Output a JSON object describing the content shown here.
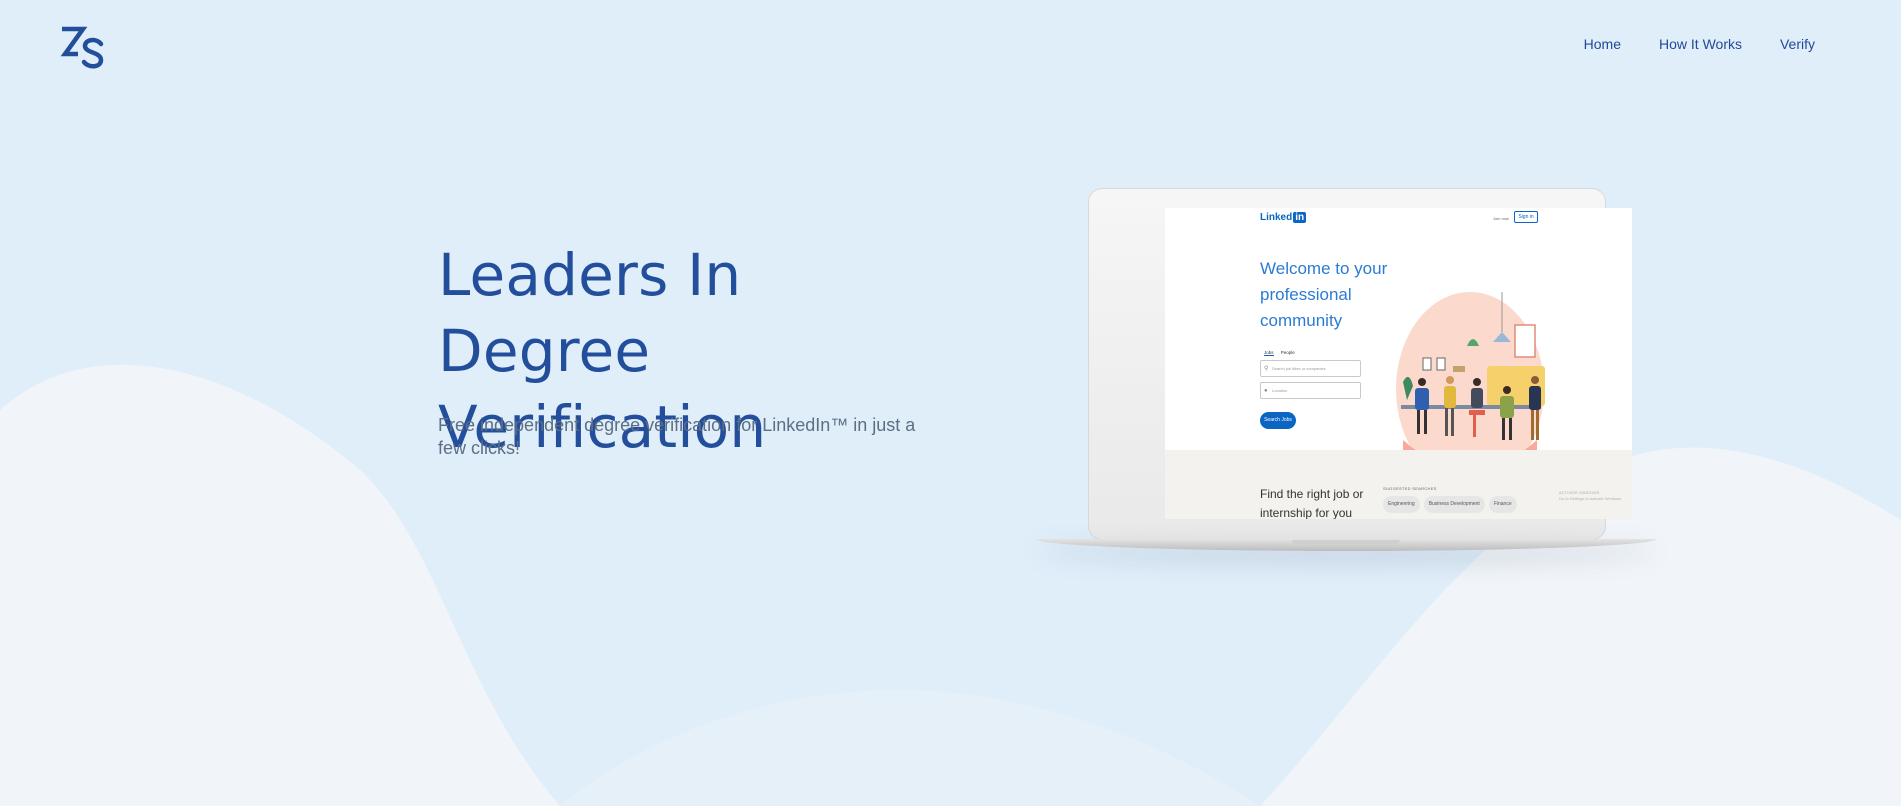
{
  "brand": {
    "logo_text": "ZS",
    "color": "#234e9c"
  },
  "nav": {
    "items": [
      "Home",
      "How It Works",
      "Verify"
    ]
  },
  "hero": {
    "title_line1": "Leaders In Degree",
    "title_line2": "Verification",
    "subtitle": "Free independent degree verification for LinkedIn™ in just a few clicks!"
  },
  "mockup": {
    "logo_text": "Linked",
    "logo_badge": "in",
    "join_now": "Join now",
    "sign_in": "Sign in",
    "welcome_line1": "Welcome to your",
    "welcome_line2": "professional",
    "welcome_line3": "community",
    "tabs": [
      "Jobs",
      "People"
    ],
    "search_placeholder": "Search job titles or companies",
    "location_placeholder": "Location",
    "search_button": "Search Jobs",
    "find_line1": "Find the right job or",
    "find_line2": "internship for you",
    "suggested_label": "SUGGESTED SEARCHES",
    "chips": [
      "Engineering",
      "Business Development",
      "Finance"
    ],
    "note_line1": "ACTIVATE WINDOWS",
    "note_line2": "Go to Settings to activate Windows."
  },
  "colors": {
    "background": "#e0eefa",
    "accent": "#234e9c",
    "linkedin_blue": "#0a66c2"
  }
}
